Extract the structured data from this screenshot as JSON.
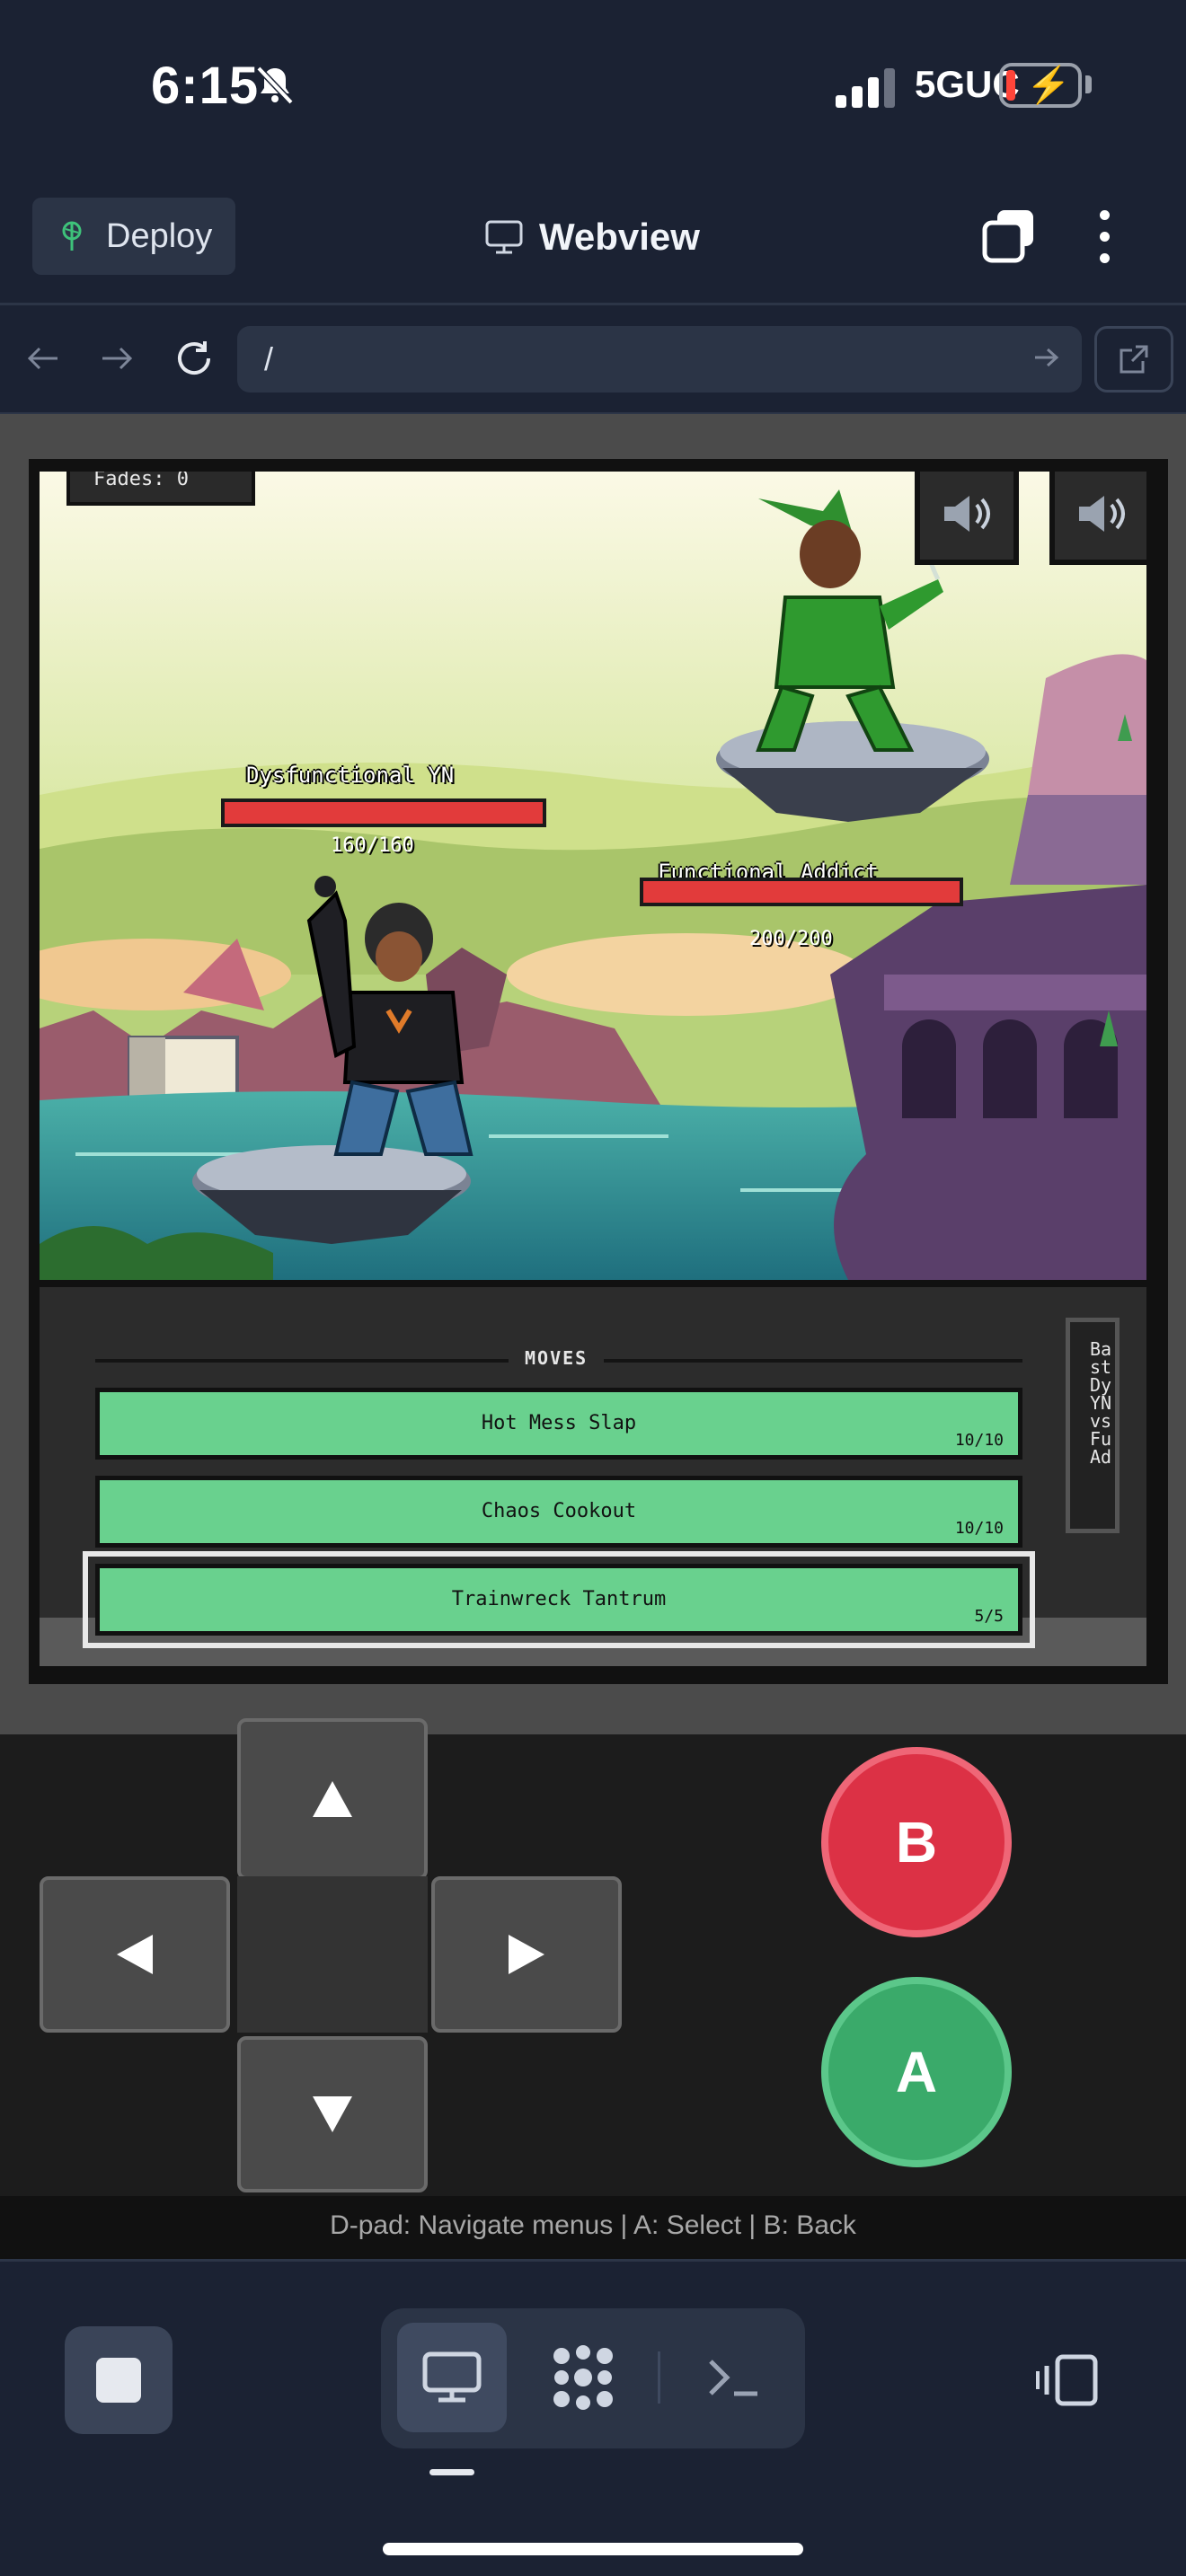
{
  "status_bar": {
    "time": "6:15",
    "network": "5GUC",
    "icons": [
      "bell-off-icon",
      "signal-icon",
      "battery-charging-icon"
    ]
  },
  "toolbar": {
    "deploy_label": "Deploy",
    "title": "Webview",
    "icons": [
      "deploy-icon",
      "monitor-icon",
      "tabs-icon",
      "more-vertical-icon"
    ]
  },
  "url_bar": {
    "value": "/",
    "icons": [
      "back-arrow-icon",
      "forward-arrow-icon",
      "reload-icon",
      "go-arrow-icon",
      "open-external-icon"
    ]
  },
  "game": {
    "fades_label": "Fades: 0",
    "player": {
      "name": "Dysfunctional YN",
      "hp_text": "160/160",
      "hp_fraction": 1.0
    },
    "opponent": {
      "name": "Functional Addict",
      "hp_text": "200/200",
      "hp_fraction": 1.0
    },
    "sound_icons": [
      "speaker-icon",
      "speaker-icon"
    ],
    "moves_title": "MOVES",
    "moves": [
      {
        "name": "Hot Mess Slap",
        "pp": "10/10"
      },
      {
        "name": "Chaos Cookout",
        "pp": "10/10"
      },
      {
        "name": "Trainwreck Tantrum",
        "pp": "5/5",
        "selected": true
      }
    ],
    "battle_log": "Ba\nst\nDy\nYN\nvs\nFu\nAd"
  },
  "controller": {
    "dpad": [
      "up",
      "left",
      "right",
      "down"
    ],
    "b_label": "B",
    "a_label": "A",
    "hint": "D-pad: Navigate menus | A: Select | B: Back"
  },
  "bottom_nav": {
    "icons": [
      "stop-icon",
      "desktop-icon",
      "apps-grid-icon",
      "terminal-icon",
      "side-panel-icon"
    ],
    "active": "desktop"
  },
  "colors": {
    "app_bg": "#1b2233",
    "hp_red": "#e23b3b",
    "move_green": "#69d18e",
    "button_b": "#dc3145",
    "button_a": "#3aaa6a"
  }
}
